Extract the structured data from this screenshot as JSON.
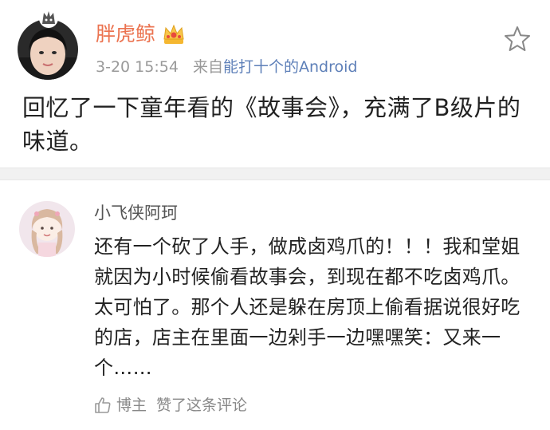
{
  "post": {
    "username": "胖虎鲸",
    "time": "3-20 15:54",
    "source_prefix": "来自",
    "source_name": "能打十个的Android",
    "text": "回忆了一下童年看的《故事会》，充满了B级片的味道。",
    "vip_icon": "crown-icon",
    "favorite_icon": "star-outline-icon"
  },
  "comment": {
    "username": "小飞侠阿珂",
    "text": "还有一个砍了人手，做成卤鸡爪的！！！我和堂姐就因为小时候偷看故事会，到现在都不吃卤鸡爪。太可怕了。那个人还是躲在房顶上偷看据说很好吃的店，店主在里面一边剁手一边嘿嘿笑：又来一个……",
    "footer_author": "博主",
    "footer_action": "赞了这条评论",
    "like_icon": "thumbs-up-icon"
  },
  "colors": {
    "username_accent": "#eb7350",
    "link": "#5d7fb8",
    "meta_gray": "#999999",
    "divider": "#f1f1f1"
  }
}
